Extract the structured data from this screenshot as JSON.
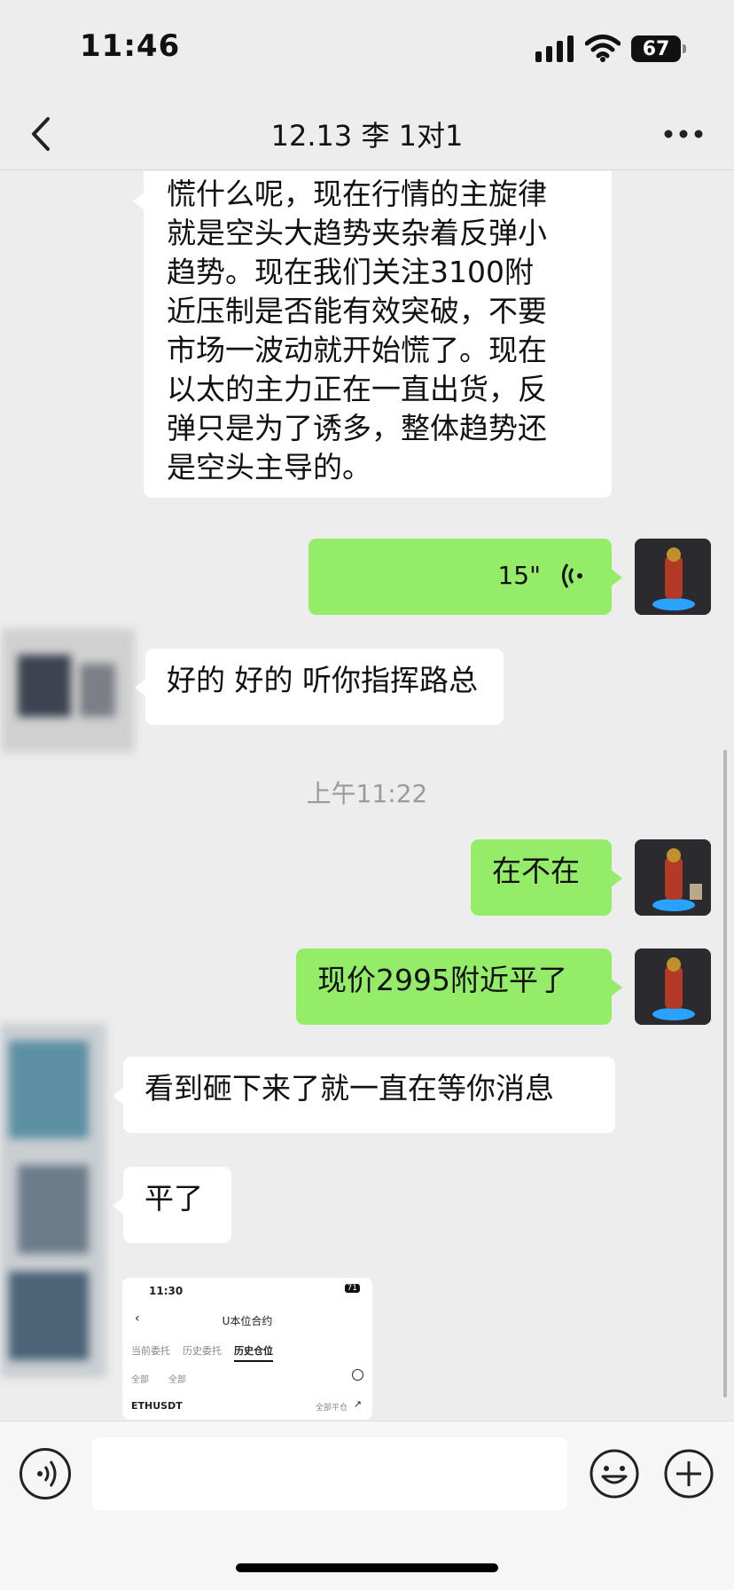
{
  "status_bar": {
    "time": "11:46",
    "battery": "67"
  },
  "header": {
    "title": "12.13 李 1对1"
  },
  "messages": {
    "m1": "慌什么呢，现在行情的主旋律\n就是空头大趋势夹杂着反弹小\n趋势。现在我们关注3100附\n近压制是否能有效突破，不要\n市场一波动就开始慌了。现在\n以太的主力正在一直出货，反\n弹只是为了诱多，整体趋势还\n是空头主导的。",
    "voice_duration": "15\"",
    "m3": "好的 好的 听你指挥路总",
    "timestamp": "上午11:22",
    "m4": "在不在",
    "m5": "现价2995附近平了",
    "m6": "看到砸下来了就一直在等你消息",
    "m7": "平了"
  },
  "screenshot_msg": {
    "time": "11:30",
    "battery": "71",
    "title": "U本位合约",
    "tabs": [
      "当前委托",
      "历史委托",
      "历史仓位"
    ],
    "filters": [
      "全部",
      "全部"
    ],
    "symbol": "ETHUSDT",
    "action": "全部平仓"
  },
  "colors": {
    "my_bubble": "#95ec69",
    "other_bubble": "#ffffff",
    "background": "#ededed"
  },
  "icons": {
    "back": "chevron-left-icon",
    "more": "more-dots-icon",
    "voice": "voice-icon",
    "emoji": "emoji-icon",
    "plus": "plus-icon"
  }
}
